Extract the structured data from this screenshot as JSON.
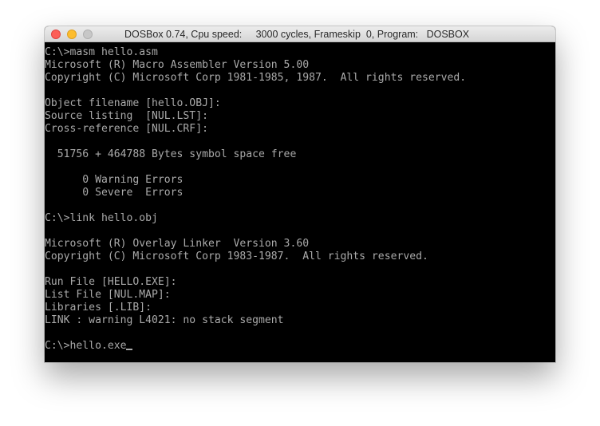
{
  "window": {
    "title": "DOSBox 0.74, Cpu speed:     3000 cycles, Frameskip  0, Program:   DOSBOX"
  },
  "controls": {
    "close_icon": "close-icon",
    "minimize_icon": "minimize-icon",
    "zoom_icon": "zoom-icon"
  },
  "console": {
    "lines": [
      "C:\\>masm hello.asm",
      "Microsoft (R) Macro Assembler Version 5.00",
      "Copyright (C) Microsoft Corp 1981-1985, 1987.  All rights reserved.",
      "",
      "Object filename [hello.OBJ]:",
      "Source listing  [NUL.LST]:",
      "Cross-reference [NUL.CRF]:",
      "",
      "  51756 + 464788 Bytes symbol space free",
      "",
      "      0 Warning Errors",
      "      0 Severe  Errors",
      "",
      "C:\\>link hello.obj",
      "",
      "Microsoft (R) Overlay Linker  Version 3.60",
      "Copyright (C) Microsoft Corp 1983-1987.  All rights reserved.",
      "",
      "Run File [HELLO.EXE]:",
      "List File [NUL.MAP]:",
      "Libraries [.LIB]:",
      "LINK : warning L4021: no stack segment",
      "",
      "C:\\>hello.exe"
    ]
  },
  "colors": {
    "screen_background": "#000000",
    "console_text": "#aaaaaa"
  }
}
